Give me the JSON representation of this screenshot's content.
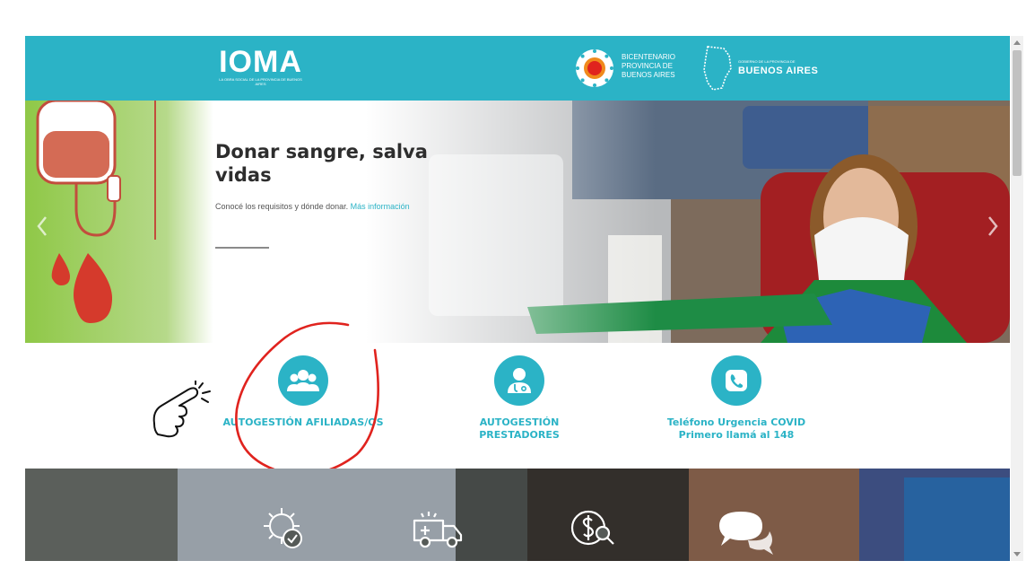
{
  "header": {
    "logo": {
      "name": "IOMA",
      "subtitle": "LA OBRA SOCIAL DE LA PROVINCIA DE BUENOS AIRES"
    },
    "bicentenario": {
      "lines": [
        "BICENTENARIO",
        "PROVINCIA DE",
        "BUENOS AIRES"
      ]
    },
    "government": {
      "small": "GOBIERNO DE LA PROVINCIA DE",
      "big": "BUENOS AIRES"
    }
  },
  "hero": {
    "title": "Donar sangre, salva vidas",
    "description": "Conocé los requisitos y dónde donar.",
    "more_link": "Más información",
    "arrows": {
      "prev": "‹",
      "next": "›"
    }
  },
  "shortcuts": [
    {
      "label": "AUTOGESTIÓN AFILIADAS/OS",
      "icon": "users-icon"
    },
    {
      "label": "AUTOGESTIÓN PRESTADORES",
      "icon": "doctor-icon"
    },
    {
      "label": "Teléfono Urgencia COVID Primero llamá al 148",
      "icon": "phone-icon"
    }
  ],
  "strip_icons": [
    "virus-icon",
    "ambulance-icon",
    "money-search-icon",
    "chat-icon"
  ],
  "colors": {
    "brand": "#2bb3c6",
    "annotation": "#e0231e"
  }
}
